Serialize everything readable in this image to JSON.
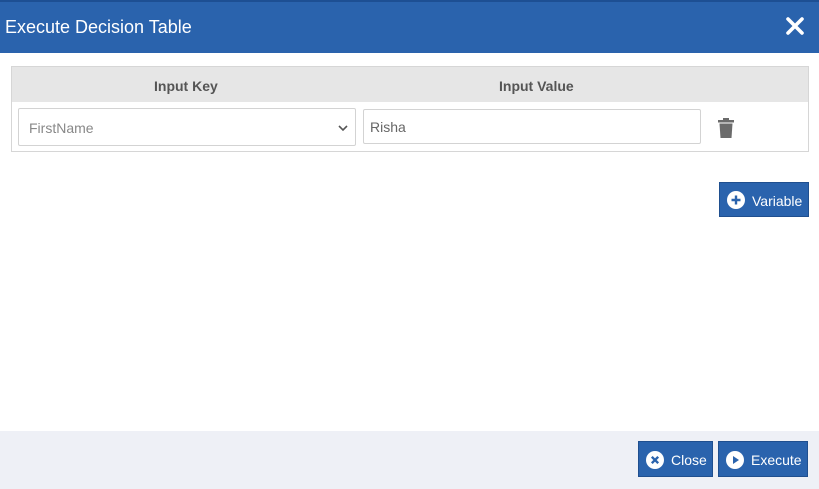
{
  "dialog": {
    "title": "Execute Decision Table",
    "close_icon": "close-icon"
  },
  "table": {
    "columns": [
      "Input Key",
      "Input Value"
    ],
    "rows": [
      {
        "key": "FirstName",
        "value": "Risha",
        "delete_icon": "trash-icon"
      }
    ]
  },
  "actions": {
    "add_variable_label": "Variable",
    "add_variable_icon": "plus-circle-icon"
  },
  "footer": {
    "close_label": "Close",
    "close_icon": "x-circle-icon",
    "execute_label": "Execute",
    "execute_icon": "play-circle-icon"
  },
  "colors": {
    "primary": "#2a63ad",
    "header_bg": "#2a63ad",
    "table_head_bg": "#e6e6e6",
    "footer_bg": "#eef0f6"
  }
}
